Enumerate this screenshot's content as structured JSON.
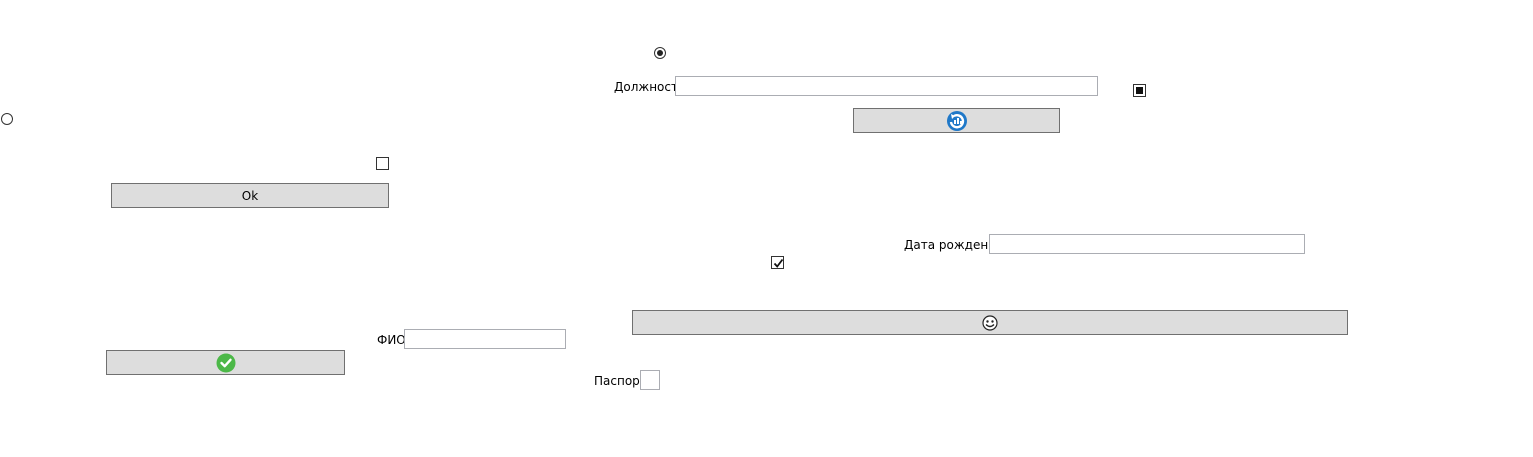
{
  "form": {
    "position_label": "Должность",
    "position_value": "",
    "birth_date_label": "Дата рождения",
    "birth_date_value": "",
    "full_name_label": "ФИО",
    "full_name_value": "",
    "passport_label": "Паспорт",
    "passport_value": ""
  },
  "buttons": {
    "ok_label": "Ok",
    "refresh_icon": "refresh-icon",
    "confirm_icon": "check-circle-icon",
    "user_icon": "user-face-icon"
  },
  "controls": {
    "radio_top_checked": true,
    "radio_left_checked": false,
    "checkbox_right_state": "indeterminate",
    "checkbox_left_state": "unchecked",
    "checkbox_middle_state": "checked"
  },
  "colors": {
    "confirm_green": "#4cb848",
    "refresh_blue": "#1f78c8",
    "button_face": "#dddddd"
  }
}
